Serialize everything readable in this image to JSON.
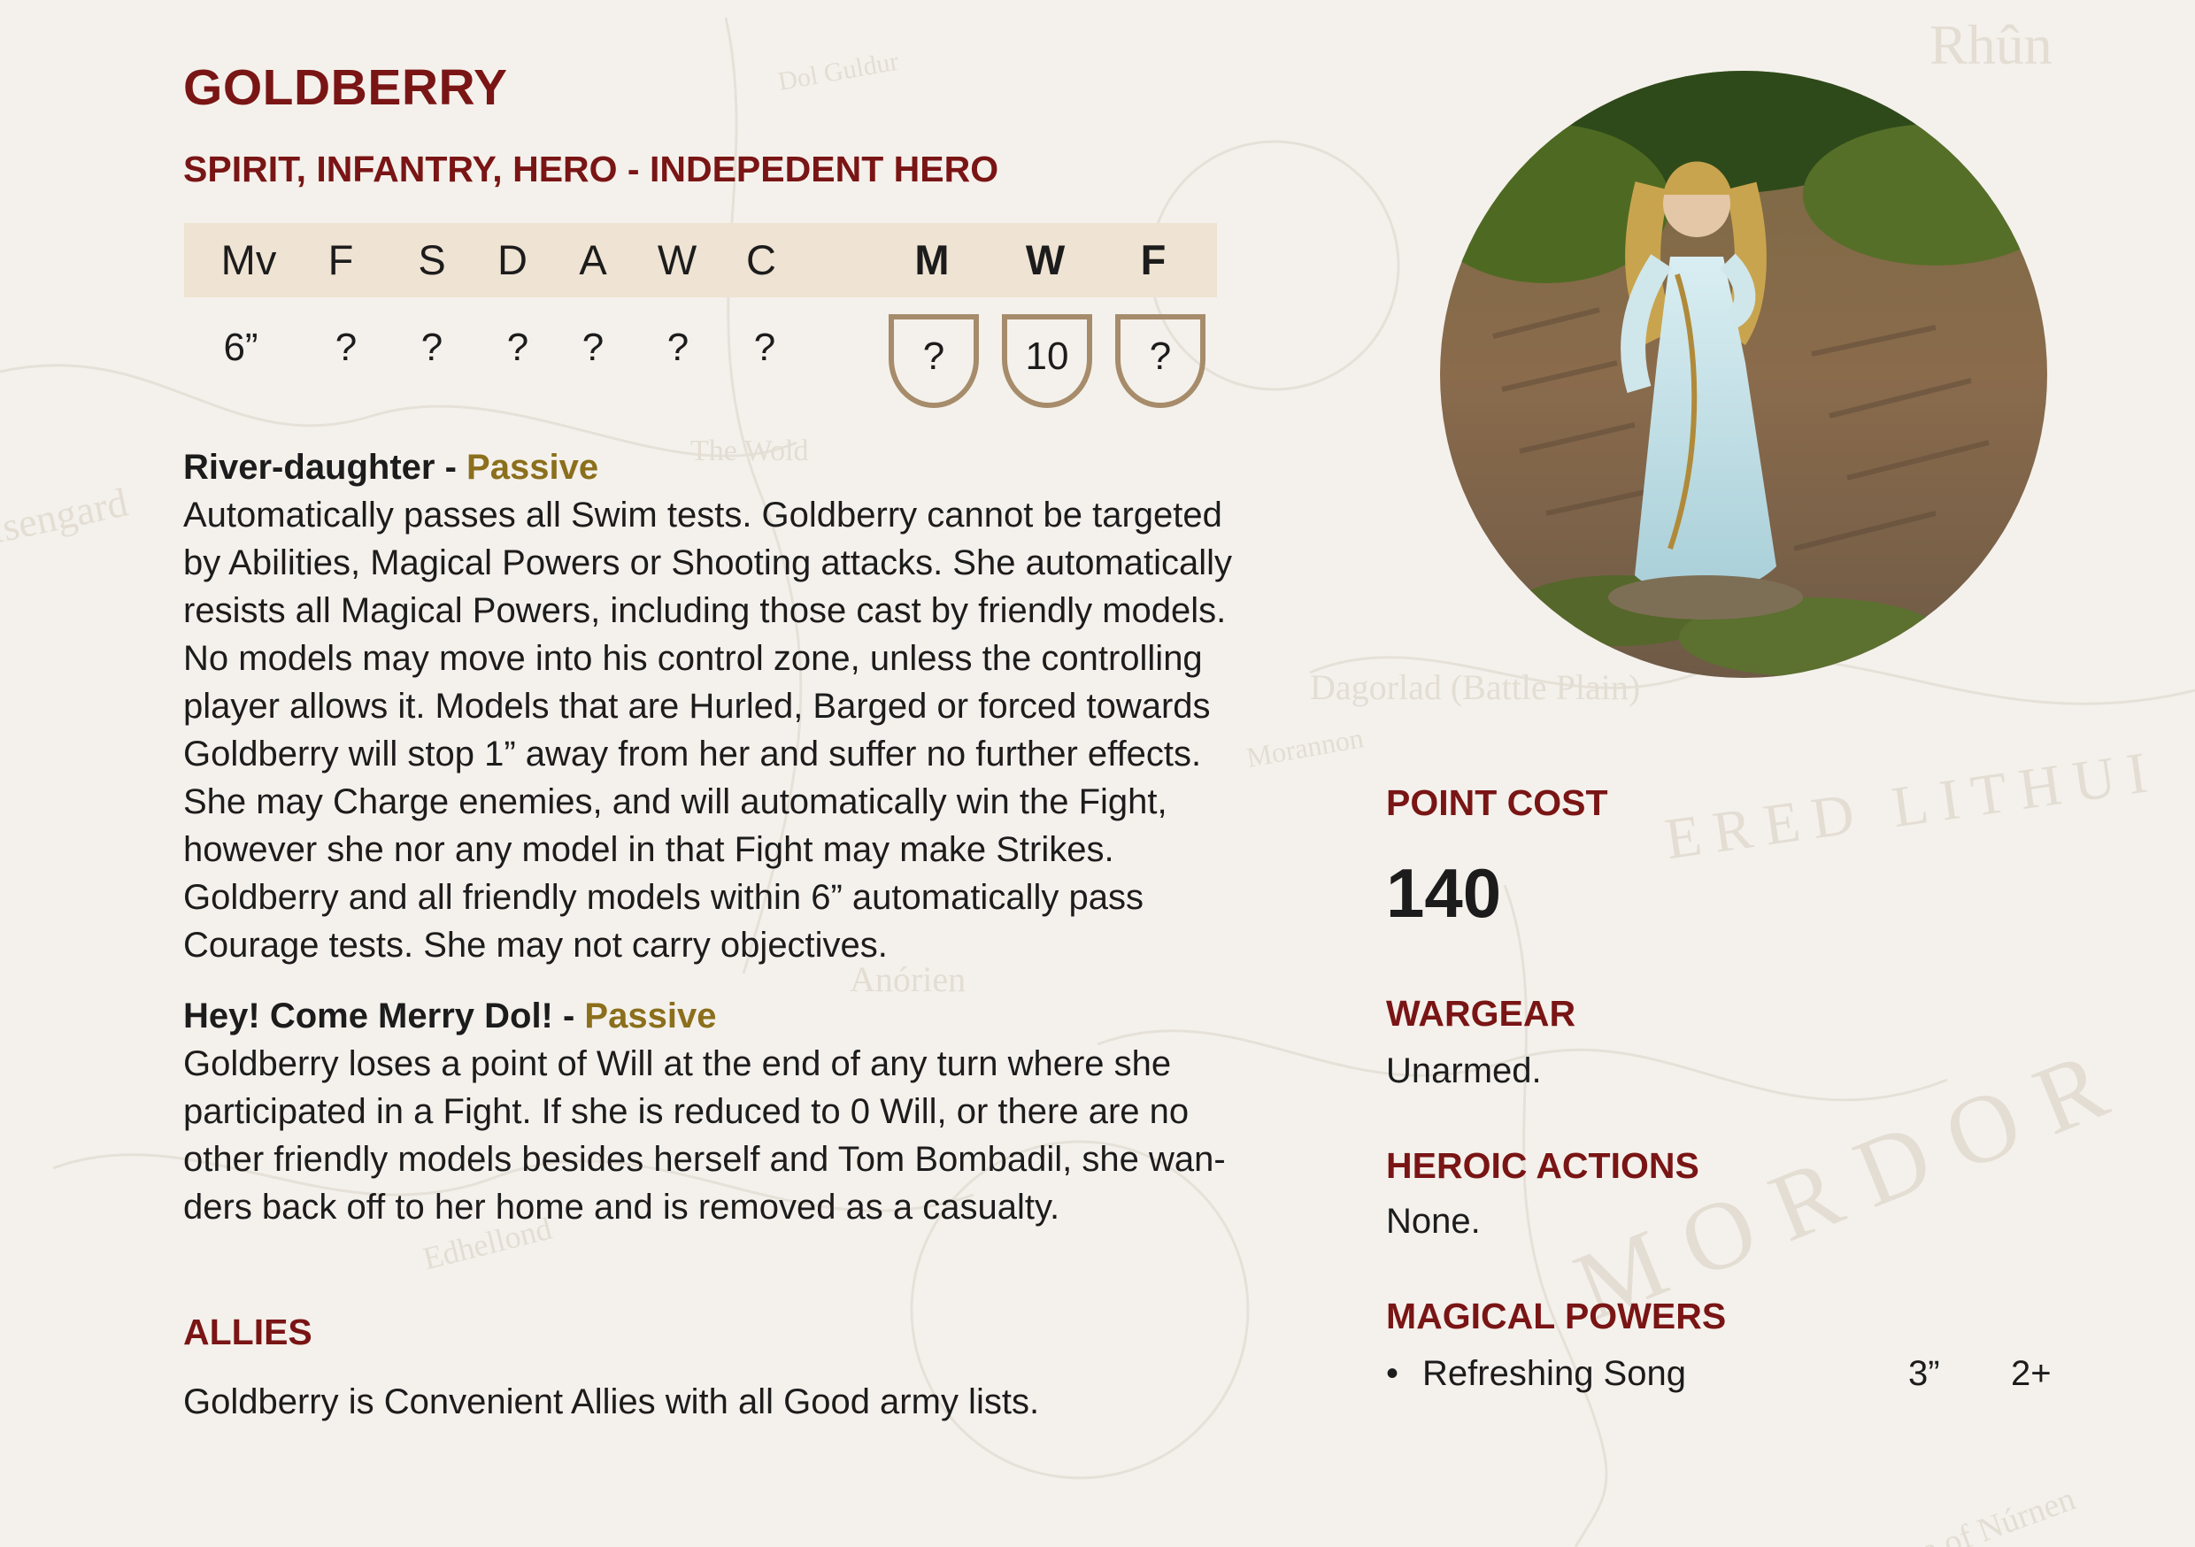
{
  "profile": {
    "name": "GOLDBERRY",
    "keywords": "SPIRIT, INFANTRY, HERO - INDEPEDENT HERO"
  },
  "stats": {
    "headers": [
      "Mv",
      "F",
      "S",
      "D",
      "A",
      "W",
      "C"
    ],
    "values": [
      "6”",
      "?",
      "?",
      "?",
      "?",
      "?",
      "?"
    ],
    "hero_headers": [
      "M",
      "W",
      "F"
    ],
    "hero_values": [
      "?",
      "10",
      "?"
    ]
  },
  "rules": [
    {
      "name": "River-daughter",
      "separator": " - ",
      "type": "Passive",
      "lines": [
        "Automatically passes all Swim tests. Goldberry cannot be targeted",
        "by Abilities, Magical Powers or Shooting attacks. She automatically",
        "resists all Magical Powers, including those cast by friendly models.",
        "No models may move into his control zone, unless the controlling",
        "player allows it. Models that are Hurled, Barged or forced towards",
        "Goldberry will stop 1” away from her and suffer no further effects.",
        "She may Charge enemies, and will automatically win the Fight,",
        "however she nor any model in that Fight may make Strikes.",
        "Goldberry and all friendly models within 6” automatically pass",
        "Courage tests. She may not carry objectives."
      ]
    },
    {
      "name": "Hey! Come Merry Dol!",
      "separator": " - ",
      "type": "Passive",
      "lines": [
        "Goldberry loses a point of Will at the end of any turn where she",
        "participated in a Fight. If she is reduced to 0 Will, or there are no",
        "other friendly models besides herself and Tom Bombadil, she wan-",
        "ders back off to her home and is removed as a casualty."
      ]
    }
  ],
  "allies": {
    "heading": "ALLIES",
    "text": "Goldberry is Convenient Allies with all Good army lists."
  },
  "side": {
    "point_cost_heading": "POINT COST",
    "point_cost": "140",
    "wargear_heading": "WARGEAR",
    "wargear": "Unarmed.",
    "heroic_heading": "HEROIC ACTIONS",
    "heroic": "None.",
    "magic_heading": "MAGICAL POWERS",
    "powers": [
      {
        "bullet": "•",
        "name": "Refreshing Song",
        "range": "3”",
        "cast": "2+"
      }
    ]
  },
  "background_map_labels": [
    "Rhûn",
    "MORDOR",
    "ERED LITHUI",
    "Isengard",
    "Dol Guldur",
    "The Wold",
    "Dagorlad (Battle Plain)",
    "Edhellond",
    "Anórien",
    "Morannon",
    "Sea of Núrnen"
  ],
  "icons": {
    "stat_shield": "shield-outline-icon",
    "bullet": "bullet-point-icon"
  },
  "colors": {
    "heading": "#7a1515",
    "passive": "#8b6f1c",
    "stat_band": "#efe3d3",
    "shield_stroke": "#a68c6b",
    "paper": "#f4f1ec"
  }
}
